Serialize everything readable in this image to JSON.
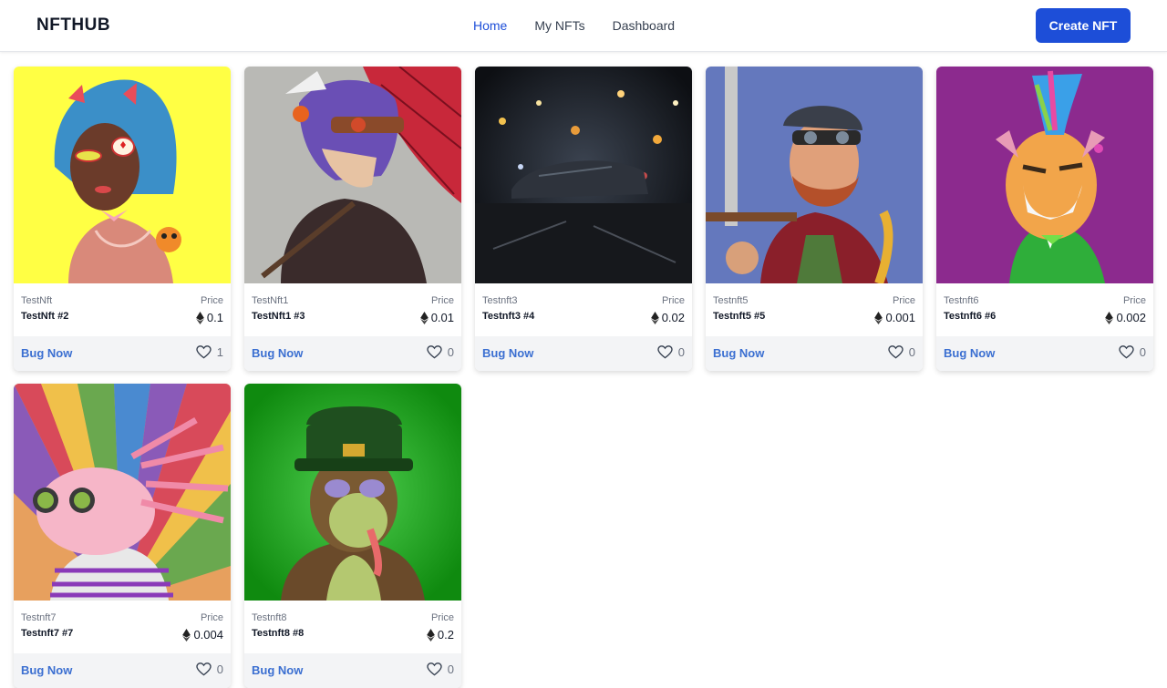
{
  "nav": {
    "brand": "NFTHUB",
    "links": [
      {
        "label": "Home",
        "active": true
      },
      {
        "label": "My NFTs",
        "active": false
      },
      {
        "label": "Dashboard",
        "active": false
      }
    ],
    "create_label": "Create NFT",
    "accent": "#1d4ed8"
  },
  "card_labels": {
    "price": "Price",
    "buy": "Bug Now",
    "currency_icon": "ethereum-icon",
    "like_icon": "heart-icon"
  },
  "nfts": [
    {
      "collection": "TestNft",
      "name": "TestNft #2",
      "price": "0.1",
      "likes": "1",
      "bg": "#ffff44",
      "subject": "girl with blue hair and horns"
    },
    {
      "collection": "TestNft1",
      "name": "TestNft1 #3",
      "price": "0.01",
      "likes": "0",
      "bg": "#b9b9b5",
      "subject": "anime boy with red umbrella"
    },
    {
      "collection": "Testnft3",
      "name": "Testnft3 #4",
      "price": "0.02",
      "likes": "0",
      "bg": "#1a1d22",
      "subject": "car in night city"
    },
    {
      "collection": "Testnft5",
      "name": "Testnft5 #5",
      "price": "0.001",
      "likes": "0",
      "bg": "#6478bd",
      "subject": "pirate with sword"
    },
    {
      "collection": "Testnft6",
      "name": "Testnft6 #6",
      "price": "0.002",
      "likes": "0",
      "bg": "#8c2a8e",
      "subject": "punk tiger"
    },
    {
      "collection": "Testnft7",
      "name": "Testnft7 #7",
      "price": "0.004",
      "likes": "0",
      "bg": "#e7a05e",
      "subject": "axolotl with goggles"
    },
    {
      "collection": "Testnft8",
      "name": "Testnft8 #8",
      "price": "0.2",
      "likes": "0",
      "bg": "#16a316",
      "subject": "ape in green hat"
    }
  ]
}
